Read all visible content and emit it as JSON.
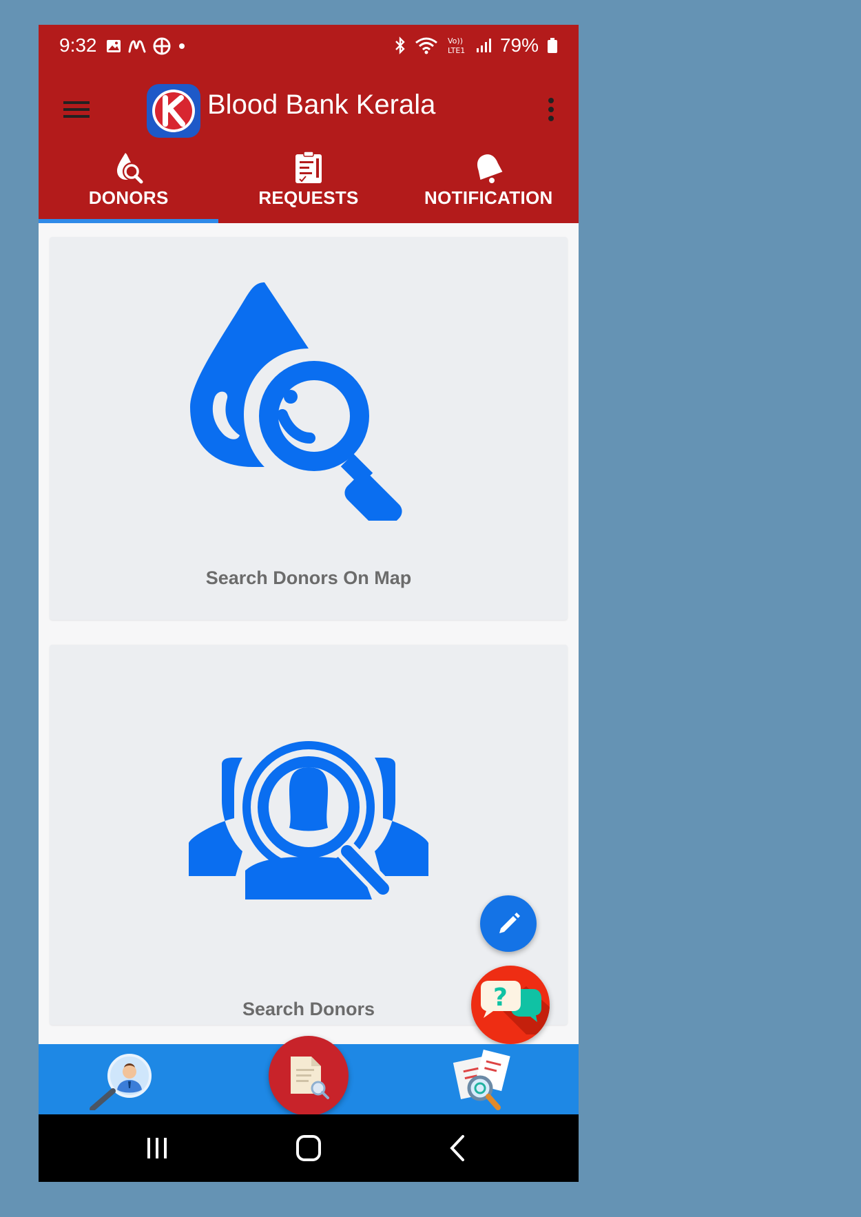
{
  "status_bar": {
    "time": "9:32",
    "battery": "79%",
    "left_icons": [
      "gallery-icon",
      "m-app-icon",
      "app-icon",
      "dot-icon"
    ],
    "right_icons": [
      "bluetooth-icon",
      "wifi-icon",
      "volte-icon",
      "signal-icon",
      "battery-icon"
    ],
    "volte_text": "Vo)) LTE1"
  },
  "app_bar": {
    "title": "Blood Bank Kerala",
    "logo_letter": "K"
  },
  "tabs": [
    {
      "label": "DONORS",
      "icon": "blood-drop-search-icon",
      "active": true
    },
    {
      "label": "REQUESTS",
      "icon": "clipboard-icon",
      "active": false
    },
    {
      "label": "NOTIFICATION",
      "icon": "bell-icon",
      "active": false
    }
  ],
  "cards": [
    {
      "label": "Search Donors On Map",
      "icon": "blood-drop-magnifier-icon"
    },
    {
      "label": "Search Donors",
      "icon": "people-magnifier-icon"
    }
  ],
  "fabs": {
    "edit_icon": "pencil-icon",
    "chat_icon": "chat-help-icon",
    "chat_text": "?"
  },
  "bottom_nav": [
    {
      "icon": "donor-search-icon"
    },
    {
      "icon": "document-search-icon"
    },
    {
      "icon": "reports-search-icon"
    }
  ],
  "colors": {
    "primary_red": "#b31b1b",
    "accent_blue": "#1473e6",
    "bottom_nav_blue": "#1e88e5",
    "tab_indicator": "#2f8ae8",
    "card_bg": "#eceef1",
    "page_bg": "#6593b4"
  }
}
